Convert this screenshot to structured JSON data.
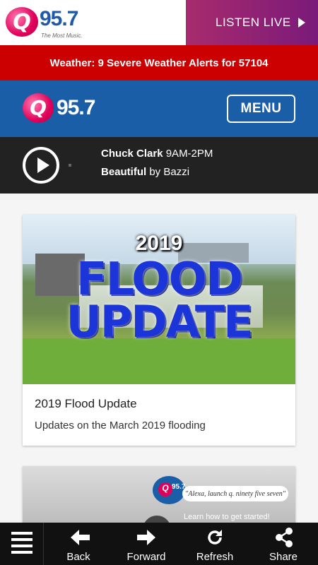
{
  "station": {
    "logo_letter": "Q",
    "logo_number": "95.7",
    "tagline": "The Most Music."
  },
  "listen_live": {
    "label": "LISTEN LIVE"
  },
  "weather_alert": {
    "text": "Weather: 9 Severe Weather Alerts for 57104"
  },
  "header": {
    "menu_label": "MENU"
  },
  "now_playing": {
    "host": "Chuck Clark",
    "time": "9AM-2PM",
    "song": "Beautiful",
    "by": "by",
    "artist": "Bazzi"
  },
  "cards": [
    {
      "image_year": "2019",
      "image_line1": "FLOOD",
      "image_line2": "UPDATE",
      "title": "2019 Flood Update",
      "description": "Updates on the March 2019 flooding"
    },
    {
      "bubble_text": "\"Alexa, launch q. ninety five seven\"",
      "learn_text": "Learn how to get started!"
    }
  ],
  "bottom_nav": {
    "back": "Back",
    "forward": "Forward",
    "refresh": "Refresh",
    "share": "Share"
  },
  "colors": {
    "brand_blue": "#1a5ea8",
    "brand_pink": "#e0005a",
    "alert_red": "#cc0000",
    "listen_purple": "#a82b6d",
    "player_bg": "#222222"
  }
}
